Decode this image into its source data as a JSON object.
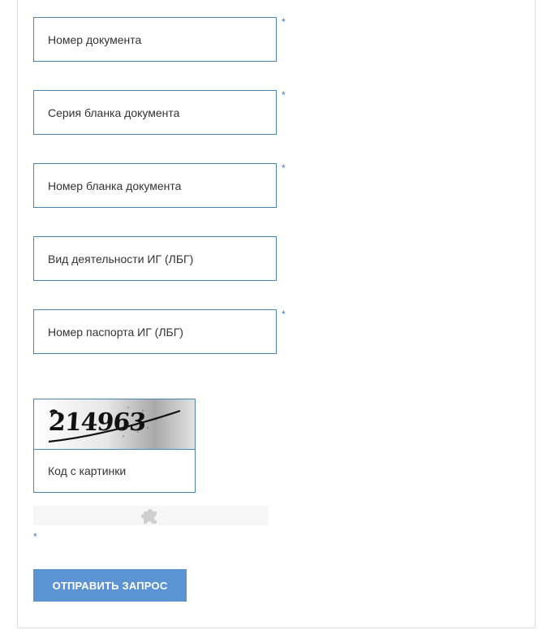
{
  "form": {
    "fields": [
      {
        "placeholder": "Номер документа",
        "required_mark": "*"
      },
      {
        "placeholder": "Серия бланка документа",
        "required_mark": "*"
      },
      {
        "placeholder": "Номер бланка документа",
        "required_mark": "*"
      },
      {
        "placeholder": "Вид деятельности ИГ (ЛБГ)",
        "required_mark": ""
      },
      {
        "placeholder": "Номер паспорта ИГ (ЛБГ)",
        "required_mark": "*"
      }
    ],
    "captcha": {
      "code": "214963",
      "placeholder": "Код с картинки",
      "required_mark": "*"
    },
    "recaptcha_icon": "puzzle-icon",
    "submit_label": "ОТПРАВИТЬ ЗАПРОС"
  },
  "colors": {
    "field_border": "#4a86b4",
    "required_mark": "#3d78b8",
    "button_bg": "#5b93d3",
    "button_text": "#ffffff"
  }
}
